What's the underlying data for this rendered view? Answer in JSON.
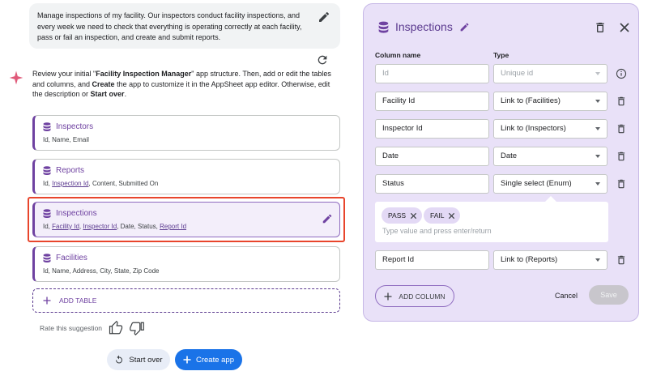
{
  "prompt": {
    "text": "Manage inspections of my facility. Our inspectors conduct facility inspections, and every week we need to check that everything is operating correctly at each facility, pass or fail an inspection, and create and submit reports."
  },
  "instructions": {
    "p1": "Review your initial \"",
    "app_name": "Facility Inspection Manager",
    "p2": "\" app structure. Then, add or edit the tables and columns, and ",
    "create_word": "Create",
    "p3": " the app to customize it in the AppSheet app editor. Otherwise, edit the description or ",
    "start_over_word": "Start over",
    "p4": "."
  },
  "tables": [
    {
      "name": "Inspectors",
      "cols_a": "Id, Name, Email"
    },
    {
      "name": "Reports",
      "cols_a": "Id, ",
      "link1": "Inspection Id",
      "cols_b": ", Content, Submitted On"
    },
    {
      "name": "Inspections",
      "cols_a": "Id, ",
      "link1": "Facility Id",
      "sep1": ", ",
      "link2": "Inspector Id",
      "sep2": ", Date, Status, ",
      "link3": "Report Id"
    },
    {
      "name": "Facilities",
      "cols_a": "Id, Name, Address, City, State, Zip Code"
    }
  ],
  "add_table_label": "ADD TABLE",
  "rate_label": "Rate this suggestion",
  "buttons": {
    "start_over": "Start over",
    "create_app": "Create app"
  },
  "panel": {
    "title": "Inspections",
    "column_name_header": "Column name",
    "type_header": "Type",
    "rows": [
      {
        "name": "",
        "placeholder": "Id",
        "type": "Unique id"
      },
      {
        "name": "Facility Id",
        "type": "Link to (Facilities)"
      },
      {
        "name": "Inspector Id",
        "type": "Link to (Inspectors)"
      },
      {
        "name": "Date",
        "type": "Date"
      },
      {
        "name": "Status",
        "type": "Single select (Enum)"
      },
      {
        "name": "Report Id",
        "type": "Link to (Reports)"
      }
    ],
    "enum_values": [
      "PASS",
      "FAIL"
    ],
    "enum_placeholder": "Type value and press enter/return",
    "add_column": "ADD COLUMN",
    "cancel": "Cancel",
    "save": "Save"
  },
  "colors": {
    "accent": "#6f42a1",
    "primary": "#1a73e8",
    "highlight": "#e8452c",
    "panel_bg": "#e9e1f8"
  }
}
